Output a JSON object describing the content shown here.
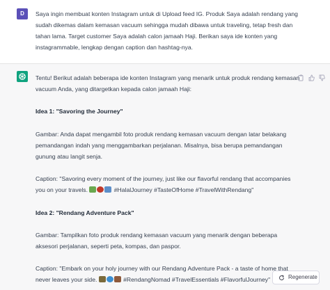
{
  "user": {
    "avatar_letter": "D",
    "message": "Saya ingin membuat konten Instagram untuk di Upload feed IG. Produk Saya adalah rendang yang sudah dikemas dalam kemasan vacuum sehingga mudah dibawa untuk traveling, tetap fresh dan tahan lama. Target customer Saya adalah calon jamaah Haji. Berikan saya ide konten yang instagrammable, lengkap dengan caption dan hashtag-nya."
  },
  "assistant": {
    "intro": "Tentu! Berikut adalah beberapa ide konten Instagram yang menarik untuk produk rendang kemasan vacuum Anda, yang ditargetkan kepada calon jamaah Haji:",
    "idea1_title": "Idea 1: \"Savoring the Journey\"",
    "idea1_gambar": "Gambar: Anda dapat mengambil foto produk rendang kemasan vacuum dengan latar belakang pemandangan indah yang menggambarkan perjalanan. Misalnya, bisa berupa pemandangan gunung atau langit senja.",
    "idea1_caption_text": "Caption: \"Savoring every moment of the journey, just like our flavorful rendang that accompanies you on your travels.",
    "idea1_hashtags": "#HalalJourney #TasteOfHome #TravelWithRendang\"",
    "idea2_title": "Idea 2: \"Rendang Adventure Pack\"",
    "idea2_gambar": "Gambar: Tampilkan foto produk rendang kemasan vacuum yang menarik dengan beberapa aksesori perjalanan, seperti peta, kompas, dan paspor.",
    "idea2_caption_text": "Caption: \"Embark on your holy journey with our Rendang Adventure Pack - a taste of home that never leaves your side.",
    "idea2_hashtags": "#RendangNomad #TravelEssentials #FlavorfulJourney\""
  },
  "regenerate_label": "Regenerate"
}
